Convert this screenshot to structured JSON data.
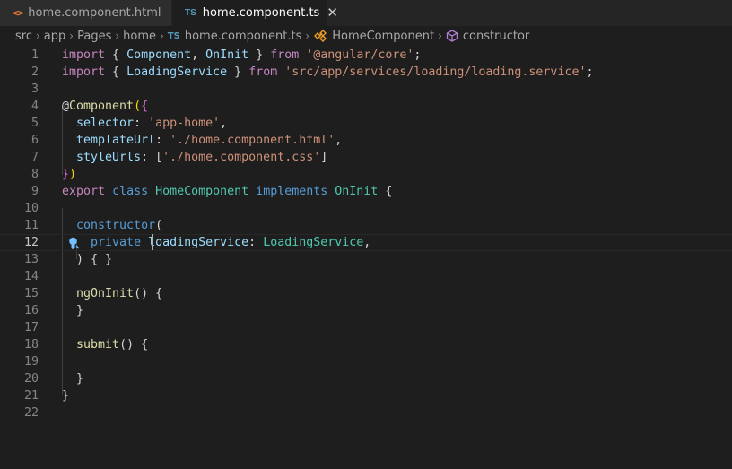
{
  "tabs": [
    {
      "label": "home.component.html",
      "icon": "html-file-icon",
      "active": false
    },
    {
      "label": "home.component.ts",
      "icon": "typescript-file-icon",
      "active": true
    }
  ],
  "breadcrumb": {
    "segments": [
      "src",
      "app",
      "Pages",
      "home",
      "home.component.ts",
      "HomeComponent",
      "constructor"
    ],
    "ts_badge": "TS"
  },
  "html_icon_glyph": "<>",
  "ts_icon_glyph": "TS",
  "close_glyph": "✕",
  "chevron_glyph": "›",
  "editor": {
    "current_line": 12,
    "lines": [
      {
        "n": "1",
        "tokens": [
          [
            "kw",
            "import"
          ],
          [
            "pun",
            " { "
          ],
          [
            "prop",
            "Component"
          ],
          [
            "pun",
            ", "
          ],
          [
            "prop",
            "OnInit"
          ],
          [
            "pun",
            " } "
          ],
          [
            "kw",
            "from"
          ],
          [
            "pun",
            " "
          ],
          [
            "str",
            "'@angular/core'"
          ],
          [
            "pun",
            ";"
          ]
        ]
      },
      {
        "n": "2",
        "tokens": [
          [
            "kw",
            "import"
          ],
          [
            "pun",
            " { "
          ],
          [
            "prop",
            "LoadingService"
          ],
          [
            "pun",
            " } "
          ],
          [
            "kw",
            "from"
          ],
          [
            "pun",
            " "
          ],
          [
            "str",
            "'src/app/services/loading/loading.service'"
          ],
          [
            "pun",
            ";"
          ]
        ]
      },
      {
        "n": "3",
        "tokens": []
      },
      {
        "n": "4",
        "tokens": [
          [
            "pun",
            "@"
          ],
          [
            "fn",
            "Component"
          ],
          [
            "brk",
            "("
          ],
          [
            "brk2",
            "{"
          ]
        ]
      },
      {
        "n": "5",
        "tokens": [
          [
            "pun",
            "  "
          ],
          [
            "prop",
            "selector"
          ],
          [
            "pun",
            ": "
          ],
          [
            "str",
            "'app-home'"
          ],
          [
            "pun",
            ","
          ]
        ]
      },
      {
        "n": "6",
        "tokens": [
          [
            "pun",
            "  "
          ],
          [
            "prop",
            "templateUrl"
          ],
          [
            "pun",
            ": "
          ],
          [
            "str",
            "'./home.component.html'"
          ],
          [
            "pun",
            ","
          ]
        ]
      },
      {
        "n": "7",
        "tokens": [
          [
            "pun",
            "  "
          ],
          [
            "prop",
            "styleUrls"
          ],
          [
            "pun",
            ": "
          ],
          [
            "pun",
            "["
          ],
          [
            "str",
            "'./home.component.css'"
          ],
          [
            "pun",
            "]"
          ]
        ]
      },
      {
        "n": "8",
        "tokens": [
          [
            "brk2",
            "}"
          ],
          [
            "brk",
            ")"
          ]
        ]
      },
      {
        "n": "9",
        "tokens": [
          [
            "kw",
            "export"
          ],
          [
            "pun",
            " "
          ],
          [
            "kb",
            "class"
          ],
          [
            "pun",
            " "
          ],
          [
            "ty",
            "HomeComponent"
          ],
          [
            "pun",
            " "
          ],
          [
            "kb",
            "implements"
          ],
          [
            "pun",
            " "
          ],
          [
            "ty",
            "OnInit"
          ],
          [
            "pun",
            " {"
          ]
        ]
      },
      {
        "n": "10",
        "tokens": []
      },
      {
        "n": "11",
        "tokens": [
          [
            "pun",
            "  "
          ],
          [
            "kb",
            "constructor"
          ],
          [
            "pun",
            "("
          ]
        ]
      },
      {
        "n": "12",
        "tokens": [
          [
            "pun",
            "    "
          ],
          [
            "kb",
            "private"
          ],
          [
            "pun",
            " "
          ],
          [
            "prop",
            "loadingService"
          ],
          [
            "pun",
            ": "
          ],
          [
            "ty",
            "LoadingService"
          ],
          [
            "pun",
            ","
          ]
        ]
      },
      {
        "n": "13",
        "tokens": [
          [
            "pun",
            "  ) { }"
          ]
        ]
      },
      {
        "n": "14",
        "tokens": []
      },
      {
        "n": "15",
        "tokens": [
          [
            "pun",
            "  "
          ],
          [
            "fn",
            "ngOnInit"
          ],
          [
            "pun",
            "() {"
          ]
        ]
      },
      {
        "n": "16",
        "tokens": [
          [
            "pun",
            "  }"
          ]
        ]
      },
      {
        "n": "17",
        "tokens": []
      },
      {
        "n": "18",
        "tokens": [
          [
            "pun",
            "  "
          ],
          [
            "fn",
            "submit"
          ],
          [
            "pun",
            "() {"
          ]
        ]
      },
      {
        "n": "19",
        "tokens": []
      },
      {
        "n": "20",
        "tokens": [
          [
            "pun",
            "  }"
          ]
        ]
      },
      {
        "n": "21",
        "tokens": [
          [
            "pun",
            "}"
          ]
        ]
      },
      {
        "n": "22",
        "tokens": []
      }
    ]
  },
  "colors": {
    "editor_bg": "#1e1e1e",
    "tabbar_bg": "#252526",
    "keyword": "#c586c0",
    "storage": "#569cd6",
    "type": "#4ec9b0",
    "function": "#dcdcaa",
    "property": "#9cdcfe",
    "string": "#ce9178"
  }
}
